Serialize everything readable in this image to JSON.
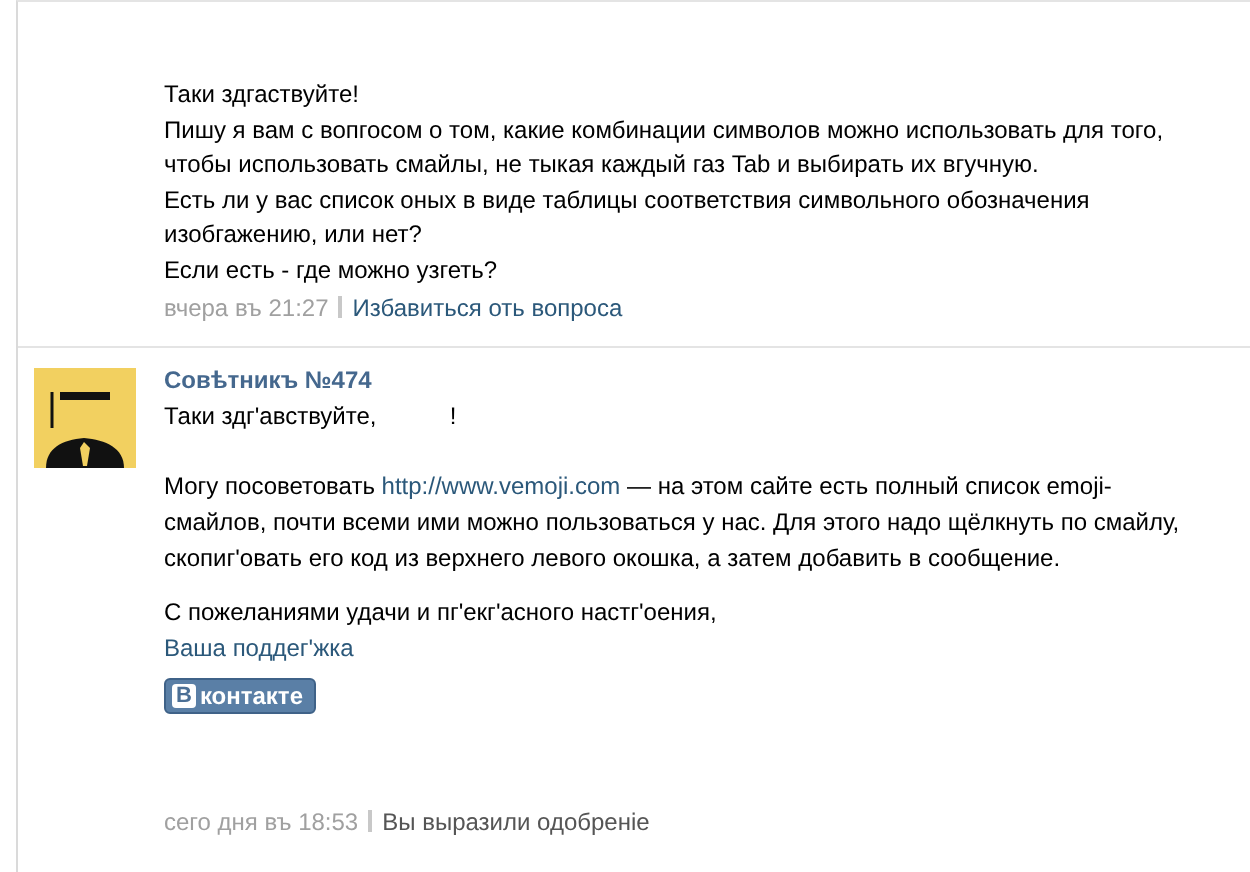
{
  "question": {
    "lines": [
      "Таки здгаствуйте!",
      "Пишу я вам с вопгосом о том, какие комбинации символов можно использовать для того, чтобы использовать смайлы, не тыкая каждый газ Tab и выбирать их вгучную.",
      "Есть ли у вас список оных в виде таблицы соответствия символьного обозначения изобгажению, или нет?",
      "Если есть - где можно узгеть?"
    ],
    "date": "вчера въ 21:27",
    "action": "Избавиться оть вопроса"
  },
  "answer": {
    "author": "Совѣтникъ №474",
    "greeting": "Таки здг'авствуйте,           !",
    "body": {
      "before": "Могу посоветовать ",
      "link": "http://www.vemoji.com",
      "after": " — на этом сайте есть полный список emoji-смайлов, почти всеми ими можно пользоваться у нас. Для этого надо щёлкнуть по смайлу, скопиг'овать его код из верхнего левого окошка, а затем добавить в сообщение."
    },
    "closing": "С пожеланиями удачи и пг'екг'асного настг'оения,",
    "signature": "Ваша поддег'жка",
    "logo": {
      "letter": "В",
      "text": "контакте"
    },
    "date": "сего дня въ 18:53",
    "status": "Вы выразили одобреніе"
  }
}
